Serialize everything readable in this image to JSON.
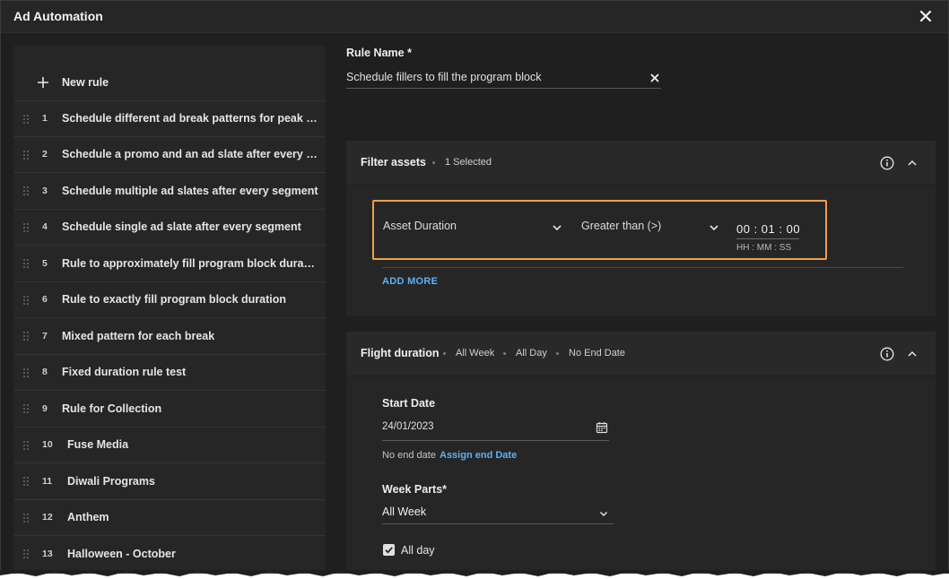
{
  "window": {
    "title": "Ad Automation"
  },
  "sidebar": {
    "new_rule_label": "New rule",
    "rules": [
      {
        "num": "1",
        "name": "Schedule different ad break patterns for peak hours"
      },
      {
        "num": "2",
        "name": "Schedule a promo and an ad slate after every segment"
      },
      {
        "num": "3",
        "name": "Schedule multiple ad slates after every segment"
      },
      {
        "num": "4",
        "name": "Schedule single ad slate after every segment"
      },
      {
        "num": "5",
        "name": "Rule to approximately fill program block duration"
      },
      {
        "num": "6",
        "name": "Rule to exactly fill program block duration"
      },
      {
        "num": "7",
        "name": "Mixed pattern for each break"
      },
      {
        "num": "8",
        "name": "Fixed duration rule test"
      },
      {
        "num": "9",
        "name": "Rule for Collection"
      },
      {
        "num": "10",
        "name": "Fuse Media"
      },
      {
        "num": "11",
        "name": "Diwali Programs"
      },
      {
        "num": "12",
        "name": "Anthem"
      },
      {
        "num": "13",
        "name": "Halloween - October"
      }
    ]
  },
  "rule_name": {
    "label": "Rule Name *",
    "value": "Schedule fillers to fill the program block"
  },
  "filter_assets": {
    "title": "Filter assets",
    "selected": "1 Selected",
    "field": "Asset Duration",
    "operator": "Greater than (>)",
    "time": "00 : 01 : 00",
    "time_hint": "HH : MM : SS",
    "add_more": "ADD MORE"
  },
  "flight_duration": {
    "title": "Flight duration",
    "tags": [
      "All Week",
      "All Day",
      "No End Date"
    ],
    "start_date_label": "Start Date",
    "start_date": "24/01/2023",
    "no_end_text": "No end date",
    "assign_end": "Assign end Date",
    "week_parts_label": "Week Parts*",
    "week_parts_value": "All Week",
    "all_day_label": "All day",
    "all_day_checked": true
  },
  "colors": {
    "accent_link": "#5fb0f0",
    "highlight_border": "#f0a04b",
    "background": "#1f1f1f",
    "panel": "#262626"
  },
  "icons": [
    "close-icon",
    "plus-icon",
    "drag-handle-icon",
    "clear-icon",
    "info-icon",
    "chevron-up-icon",
    "chevron-down-icon",
    "calendar-icon",
    "checkbox-checked-icon"
  ]
}
